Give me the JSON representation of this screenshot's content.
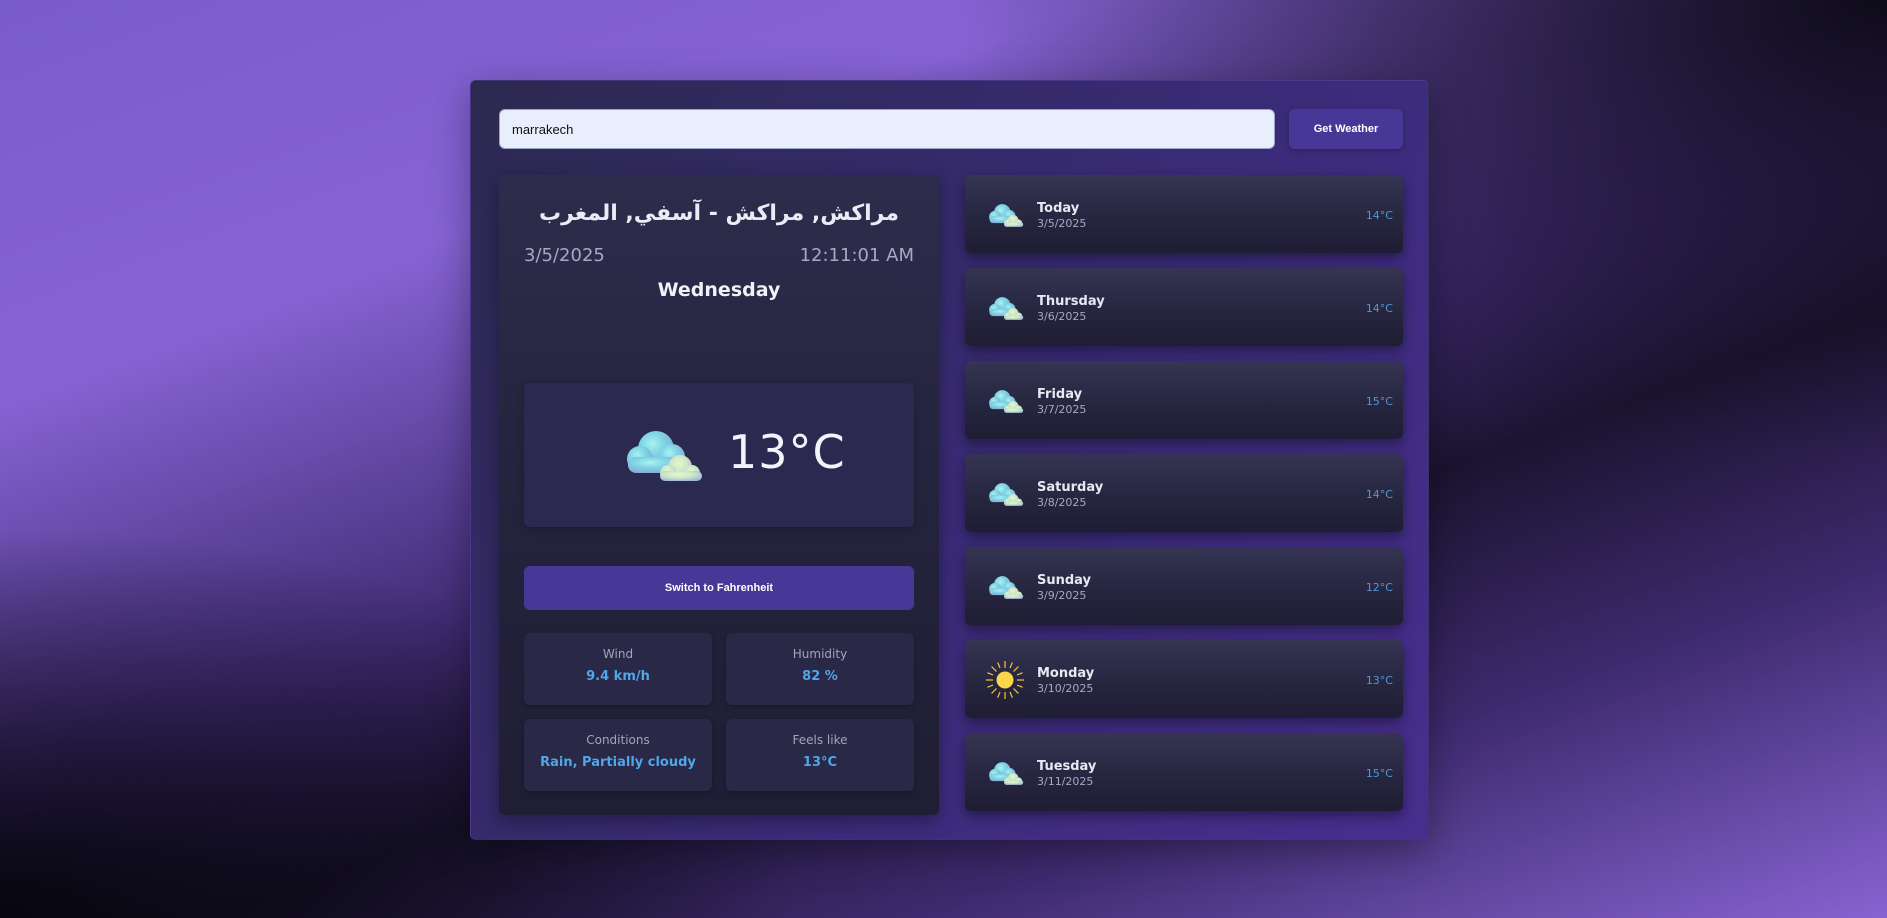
{
  "search": {
    "value": "marrakech",
    "button_label": "Get Weather"
  },
  "current": {
    "location": "مراكش, مراكش - آسفي, المغرب",
    "date": "3/5/2025",
    "time": "12:11:01 AM",
    "day": "Wednesday",
    "icon": "cloud-icon",
    "temperature": "13°C",
    "switch_label": "Switch to Fahrenheit",
    "stats": {
      "wind": {
        "label": "Wind",
        "value": "9.4 km/h"
      },
      "humidity": {
        "label": "Humidity",
        "value": "82 %"
      },
      "conditions": {
        "label": "Conditions",
        "value": "Rain, Partially cloudy"
      },
      "feels_like": {
        "label": "Feels like",
        "value": "13°C"
      }
    }
  },
  "forecast": [
    {
      "day": "Today",
      "date": "3/5/2025",
      "temp": "14°C",
      "icon": "cloud-icon"
    },
    {
      "day": "Thursday",
      "date": "3/6/2025",
      "temp": "14°C",
      "icon": "cloud-icon"
    },
    {
      "day": "Friday",
      "date": "3/7/2025",
      "temp": "15°C",
      "icon": "cloud-icon"
    },
    {
      "day": "Saturday",
      "date": "3/8/2025",
      "temp": "14°C",
      "icon": "cloud-icon"
    },
    {
      "day": "Sunday",
      "date": "3/9/2025",
      "temp": "12°C",
      "icon": "cloud-icon"
    },
    {
      "day": "Monday",
      "date": "3/10/2025",
      "temp": "13°C",
      "icon": "sun-icon"
    },
    {
      "day": "Tuesday",
      "date": "3/11/2025",
      "temp": "15°C",
      "icon": "cloud-icon"
    }
  ],
  "colors": {
    "accent": "#473897",
    "stat_value": "#4fa6e8",
    "forecast_temp": "#4f98d8"
  }
}
